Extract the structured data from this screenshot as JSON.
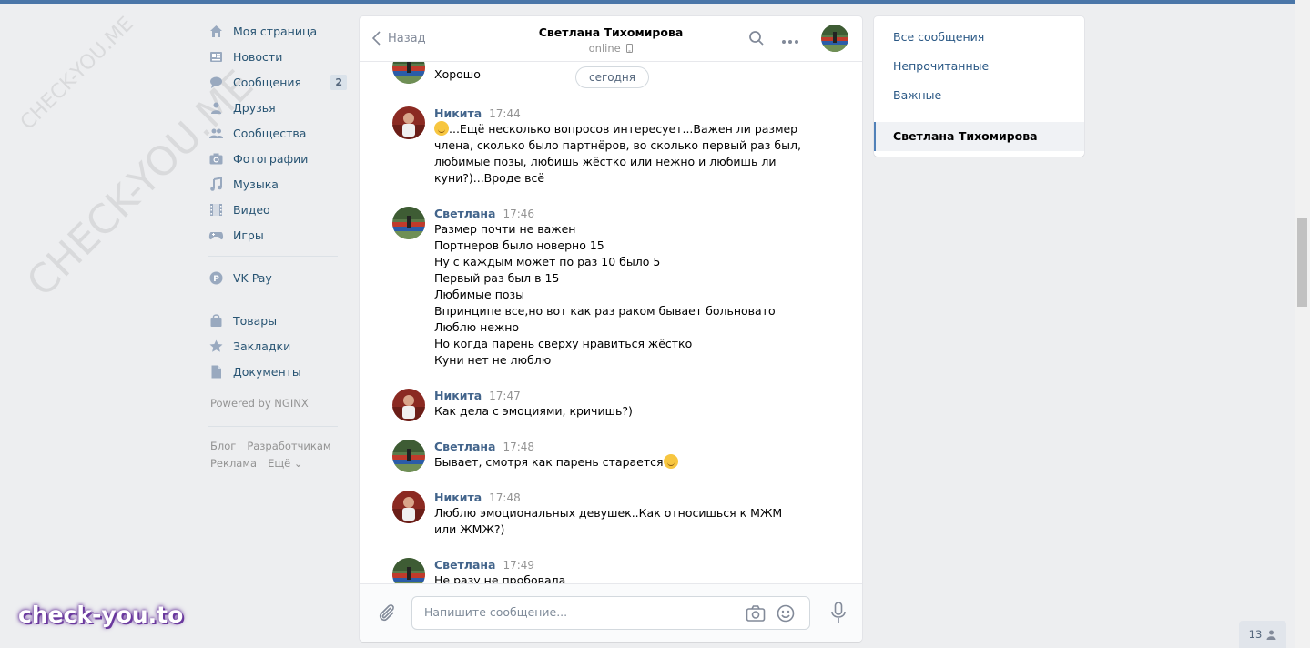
{
  "nav": {
    "items": [
      {
        "label": "Моя страница",
        "icon": "home-icon"
      },
      {
        "label": "Новости",
        "icon": "news-icon"
      },
      {
        "label": "Сообщения",
        "icon": "messages-icon",
        "badge": "2"
      },
      {
        "label": "Друзья",
        "icon": "friends-icon"
      },
      {
        "label": "Сообщества",
        "icon": "groups-icon"
      },
      {
        "label": "Фотографии",
        "icon": "camera-icon"
      },
      {
        "label": "Музыка",
        "icon": "music-icon"
      },
      {
        "label": "Видео",
        "icon": "video-icon"
      },
      {
        "label": "Игры",
        "icon": "gamepad-icon"
      }
    ],
    "vkpay": {
      "label": "VK Pay",
      "icon": "vkpay-icon"
    },
    "extra": [
      {
        "label": "Товары",
        "icon": "bag-icon"
      },
      {
        "label": "Закладки",
        "icon": "star-icon"
      },
      {
        "label": "Документы",
        "icon": "document-icon"
      }
    ],
    "powered": "Powered by NGINX",
    "footer": {
      "blog": "Блог",
      "dev": "Разработчикам",
      "ads": "Реклама",
      "more": "Ещё ⌄"
    }
  },
  "chat": {
    "back_label": "Назад",
    "peer_name": "Светлана Тихомирова",
    "peer_status": "online",
    "date_pill": "сегодня",
    "first_fragment": "Хорошо",
    "messages": [
      {
        "author": "Никита",
        "time": "17:44",
        "lines": [
          "...Ещё несколько вопросов интересует...Важен ли размер",
          "члена, сколько было партнёров, во сколько первый раз был,",
          "любимые позы, любишь жёстко или нежно и любишь ли",
          "куни?)...Вроде всё"
        ]
      },
      {
        "author": "Светлана",
        "time": "17:46",
        "lines": [
          "Размер почти не важен",
          "Портнеров было новерно 15",
          "Ну с каждым может по раз 10 было 5",
          "Первый раз был в 15",
          "Любимые позы",
          "Впринципе все,но вот как раз раком бывает больновато",
          "Люблю нежно",
          "Но когда парень сверху нравиться жёстко",
          "Куни нет не люблю"
        ]
      },
      {
        "author": "Никита",
        "time": "17:47",
        "lines": [
          "Как дела с эмоциями, кричишь?)"
        ]
      },
      {
        "author": "Светлана",
        "time": "17:48",
        "lines": [
          "Бывает, смотря как парень старается"
        ]
      },
      {
        "author": "Никита",
        "time": "17:48",
        "lines": [
          "Люблю эмоциональных девушек..Как относишься к МЖМ",
          "или ЖМЖ?)"
        ]
      },
      {
        "author": "Светлана",
        "time": "17:49",
        "lines": [
          "Не разу не пробовала"
        ]
      }
    ],
    "composer_placeholder": "Напишите сообщение..."
  },
  "filters": {
    "all": "Все сообщения",
    "unread": "Непрочитанные",
    "important": "Важные",
    "active_dialog": "Светлана Тихомирова"
  },
  "online_count": "13",
  "watermark": {
    "small": "CHECK-YOU.ME",
    "big": "CHECK-YOU.ME",
    "logo": "check-you.to"
  },
  "colors": {
    "accent": "#4a76a8",
    "link": "#2a5885",
    "author": "#42648b"
  }
}
